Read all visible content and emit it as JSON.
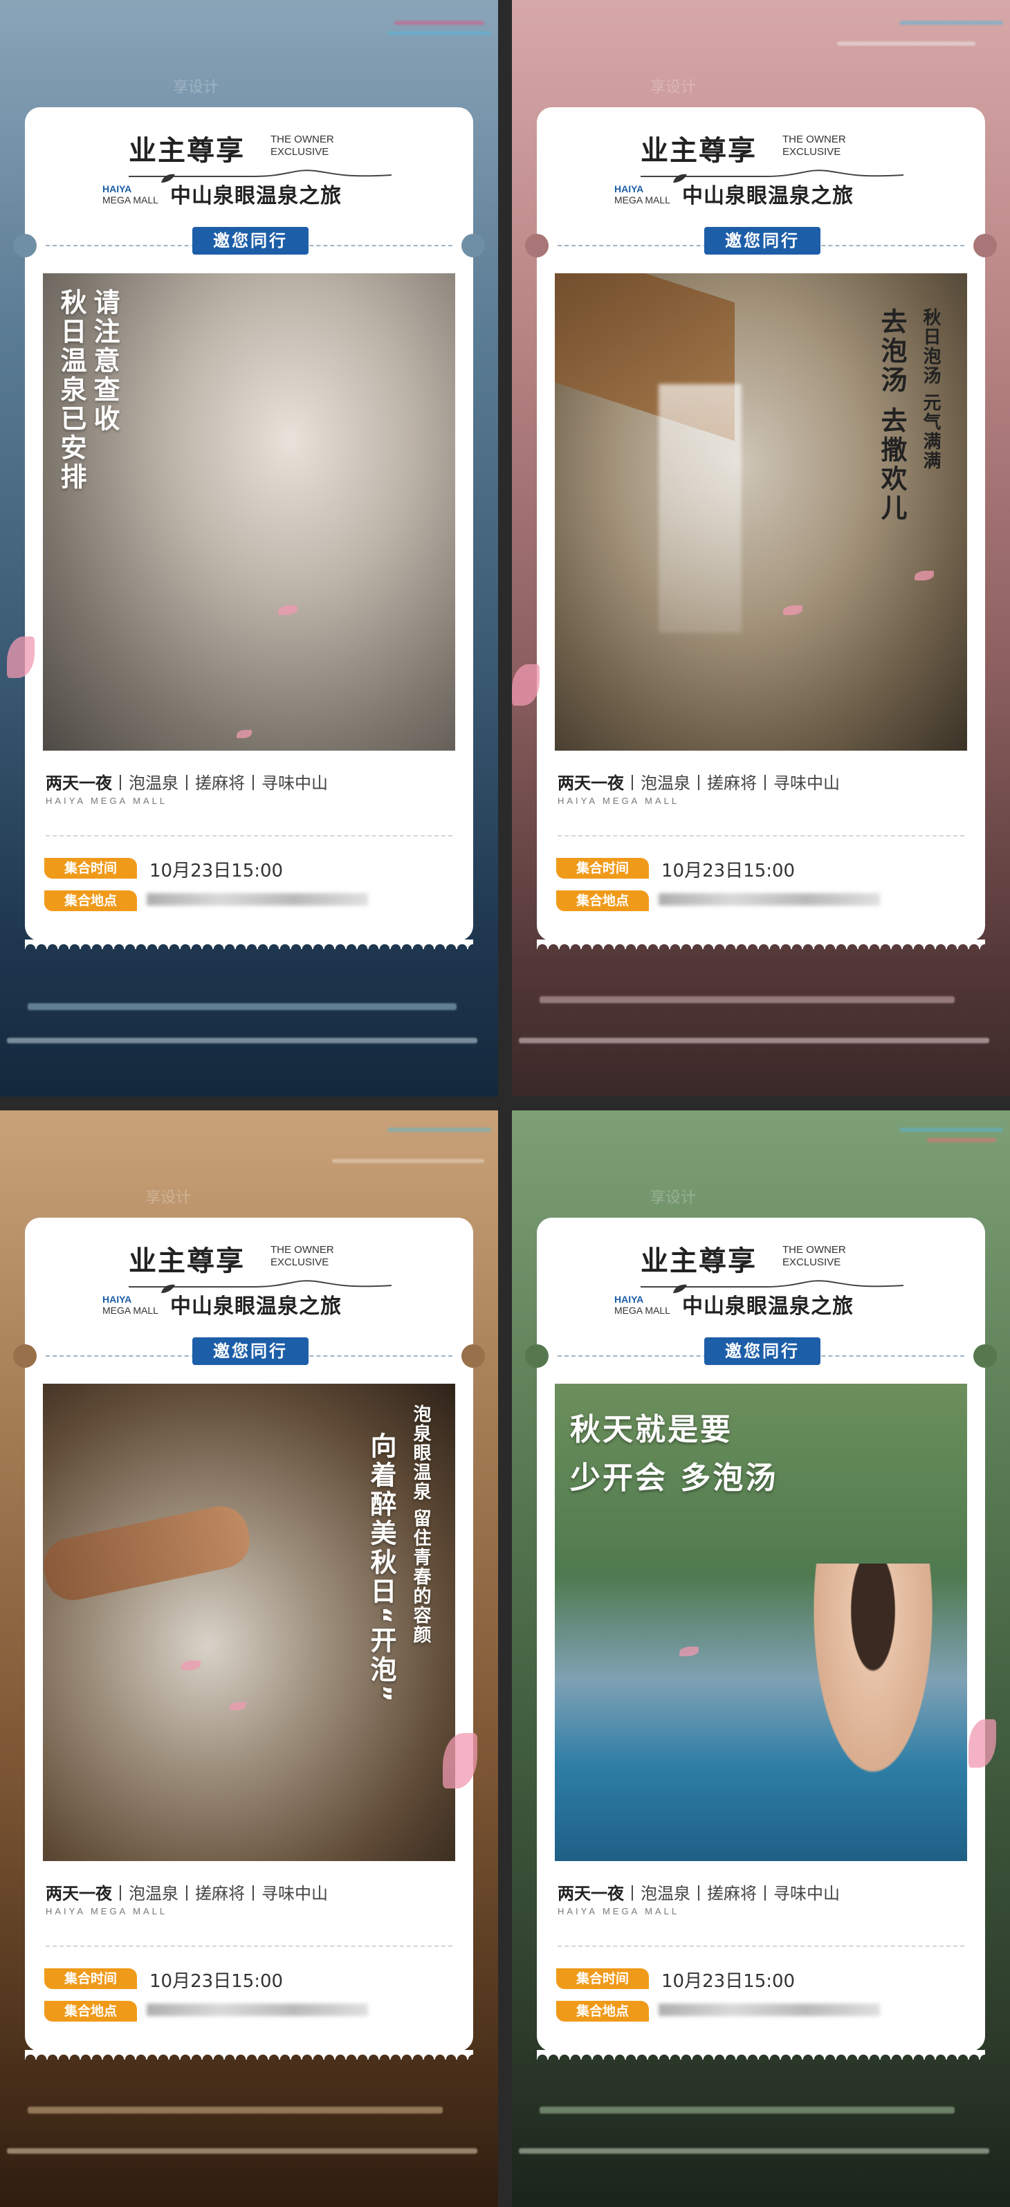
{
  "posters": [
    {
      "header": {
        "title": "业主尊享",
        "owner_line1": "THE OWNER",
        "owner_line2": "EXCLUSIVE",
        "brand_line1": "HAIYA",
        "brand_line2": "MEGA MALL",
        "subtitle": "中山泉眼温泉之旅"
      },
      "invite": "邀您同行",
      "photo_text": {
        "col1": "秋日温泉已安排",
        "col2": "请注意查收"
      },
      "details": {
        "itinerary_bold": "两天一夜",
        "itinerary_rest": "丨泡温泉丨搓麻将丨寻味中山",
        "mall": "HAIYA MEGA MALL"
      },
      "meeting": {
        "time_label": "集合时间",
        "time_value": "10月23日15:00",
        "place_label": "集合地点"
      }
    },
    {
      "header": {
        "title": "业主尊享",
        "owner_line1": "THE OWNER",
        "owner_line2": "EXCLUSIVE",
        "brand_line1": "HAIYA",
        "brand_line2": "MEGA MALL",
        "subtitle": "中山泉眼温泉之旅"
      },
      "invite": "邀您同行",
      "photo_text": {
        "col1": "去泡汤 去撒欢儿",
        "col2": "秋日泡汤 元气满满"
      },
      "details": {
        "itinerary_bold": "两天一夜",
        "itinerary_rest": "丨泡温泉丨搓麻将丨寻味中山",
        "mall": "HAIYA MEGA MALL"
      },
      "meeting": {
        "time_label": "集合时间",
        "time_value": "10月23日15:00",
        "place_label": "集合地点"
      }
    },
    {
      "header": {
        "title": "业主尊享",
        "owner_line1": "THE OWNER",
        "owner_line2": "EXCLUSIVE",
        "brand_line1": "HAIYA",
        "brand_line2": "MEGA MALL",
        "subtitle": "中山泉眼温泉之旅"
      },
      "invite": "邀您同行",
      "photo_text": {
        "col1": "向着醉美秋日“开泡”",
        "col2": "泡泉眼温泉 留住青春的容颜"
      },
      "details": {
        "itinerary_bold": "两天一夜",
        "itinerary_rest": "丨泡温泉丨搓麻将丨寻味中山",
        "mall": "HAIYA MEGA MALL"
      },
      "meeting": {
        "time_label": "集合时间",
        "time_value": "10月23日15:00",
        "place_label": "集合地点"
      }
    },
    {
      "header": {
        "title": "业主尊享",
        "owner_line1": "THE OWNER",
        "owner_line2": "EXCLUSIVE",
        "brand_line1": "HAIYA",
        "brand_line2": "MEGA MALL",
        "subtitle": "中山泉眼温泉之旅"
      },
      "invite": "邀您同行",
      "photo_text": {
        "col1": "秋天就是要",
        "col2": "少开会 多泡汤"
      },
      "details": {
        "itinerary_bold": "两天一夜",
        "itinerary_rest": "丨泡温泉丨搓麻将丨寻味中山",
        "mall": "HAIYA MEGA MALL"
      },
      "meeting": {
        "time_label": "集合时间",
        "time_value": "10月23日15:00",
        "place_label": "集合地点"
      }
    }
  ],
  "watermark": "享设计",
  "colors": {
    "accent_blue": "#1d5ea8",
    "tag_orange": "#f09a1a",
    "petal_pink": "#f09ab0"
  }
}
